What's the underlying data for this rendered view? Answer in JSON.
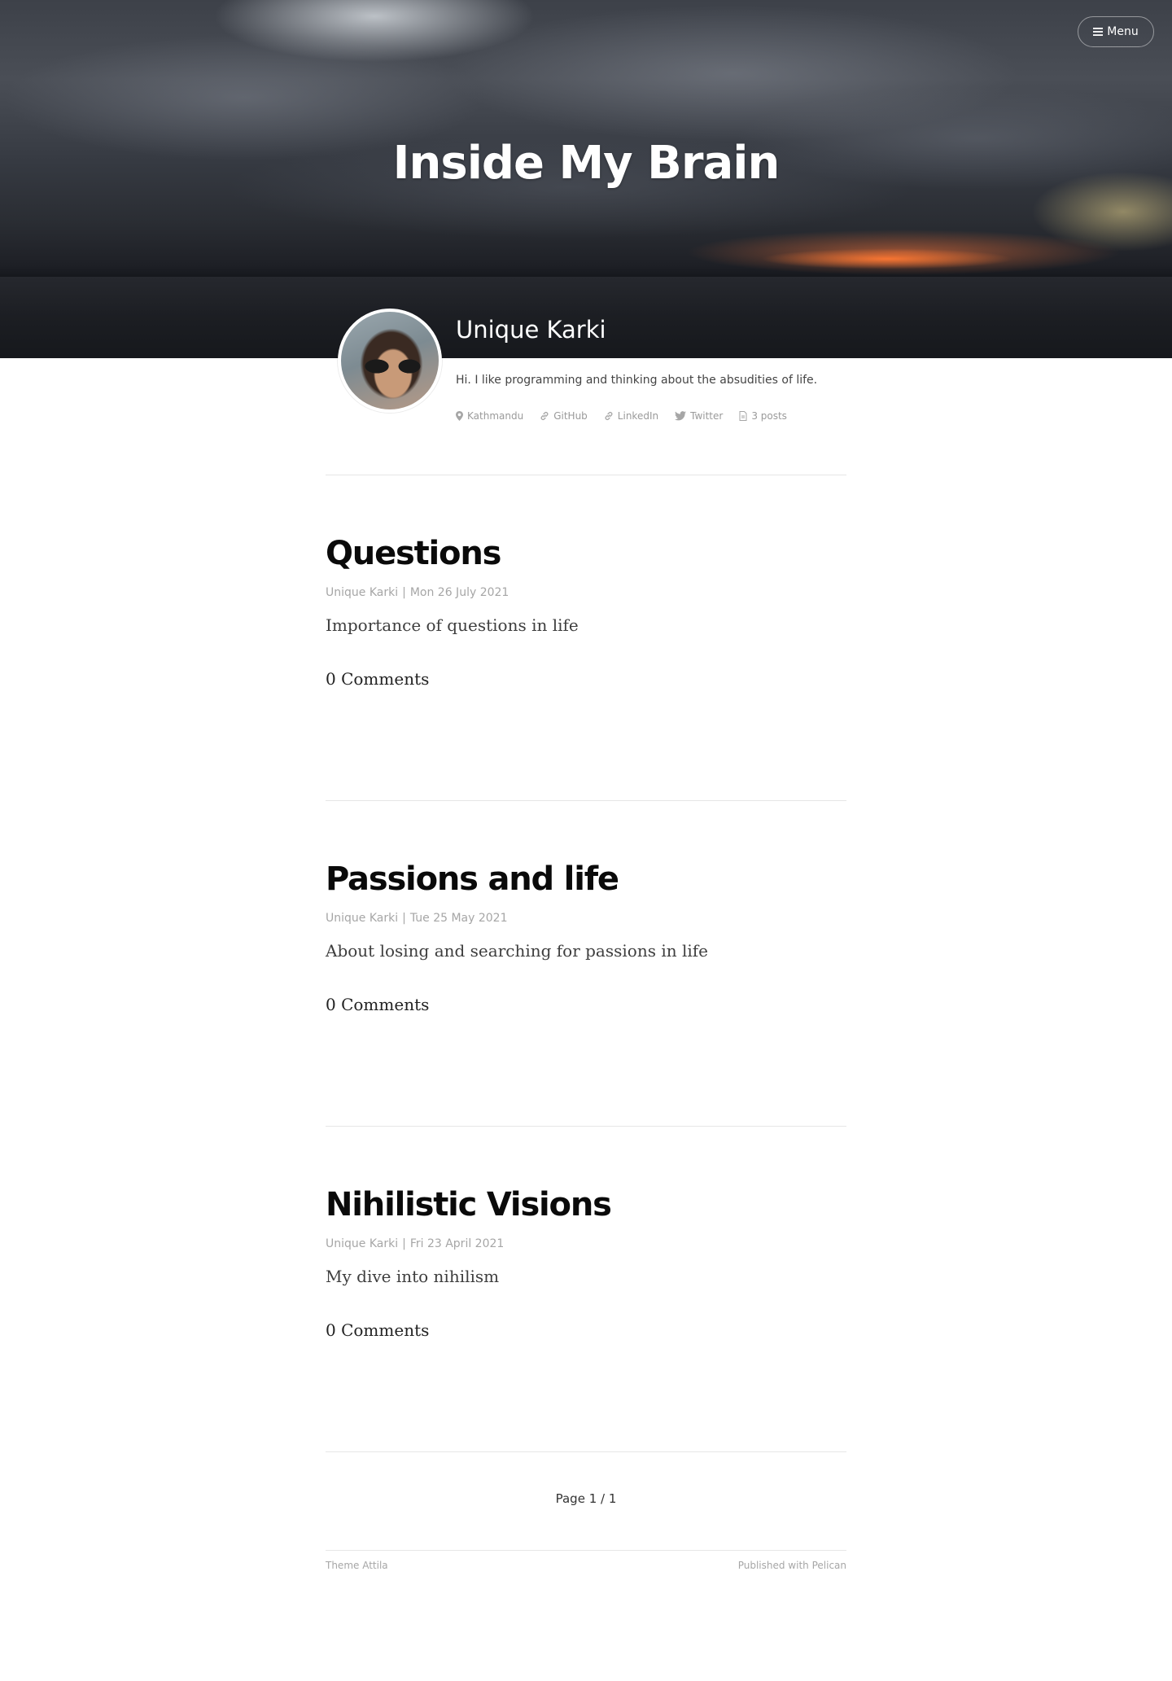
{
  "site": {
    "title": "Inside My Brain",
    "menu_label": "Menu"
  },
  "author": {
    "name": "Unique Karki",
    "bio": "Hi. I like programming and thinking about the absudities of life.",
    "location": "Kathmandu",
    "links": {
      "github": "GitHub",
      "linkedin": "LinkedIn",
      "twitter": "Twitter"
    },
    "posts_count": "3 posts"
  },
  "posts": [
    {
      "title": "Questions",
      "author": "Unique Karki",
      "separator": "|",
      "date": "Mon 26 July 2021",
      "summary": "Importance of questions in life",
      "comments": "0 Comments"
    },
    {
      "title": "Passions and life",
      "author": "Unique Karki",
      "separator": "|",
      "date": "Tue 25 May 2021",
      "summary": "About losing and searching for passions in life",
      "comments": "0 Comments"
    },
    {
      "title": "Nihilistic Visions",
      "author": "Unique Karki",
      "separator": "|",
      "date": "Fri 23 April 2021",
      "summary": "My dive into nihilism",
      "comments": "0 Comments"
    }
  ],
  "pagination": {
    "label": "Page 1 / 1"
  },
  "footer": {
    "theme": "Theme Attila",
    "published": "Published with Pelican"
  },
  "colors": {
    "title_text": "#0a0a0a",
    "meta_text": "#a6a6a6",
    "divider": "#e6e6e6"
  },
  "icons": {
    "menu": "hamburger-icon",
    "location": "map-pin-icon",
    "github": "link-icon",
    "linkedin": "link-icon",
    "twitter": "twitter-bird-icon",
    "posts": "document-icon"
  }
}
